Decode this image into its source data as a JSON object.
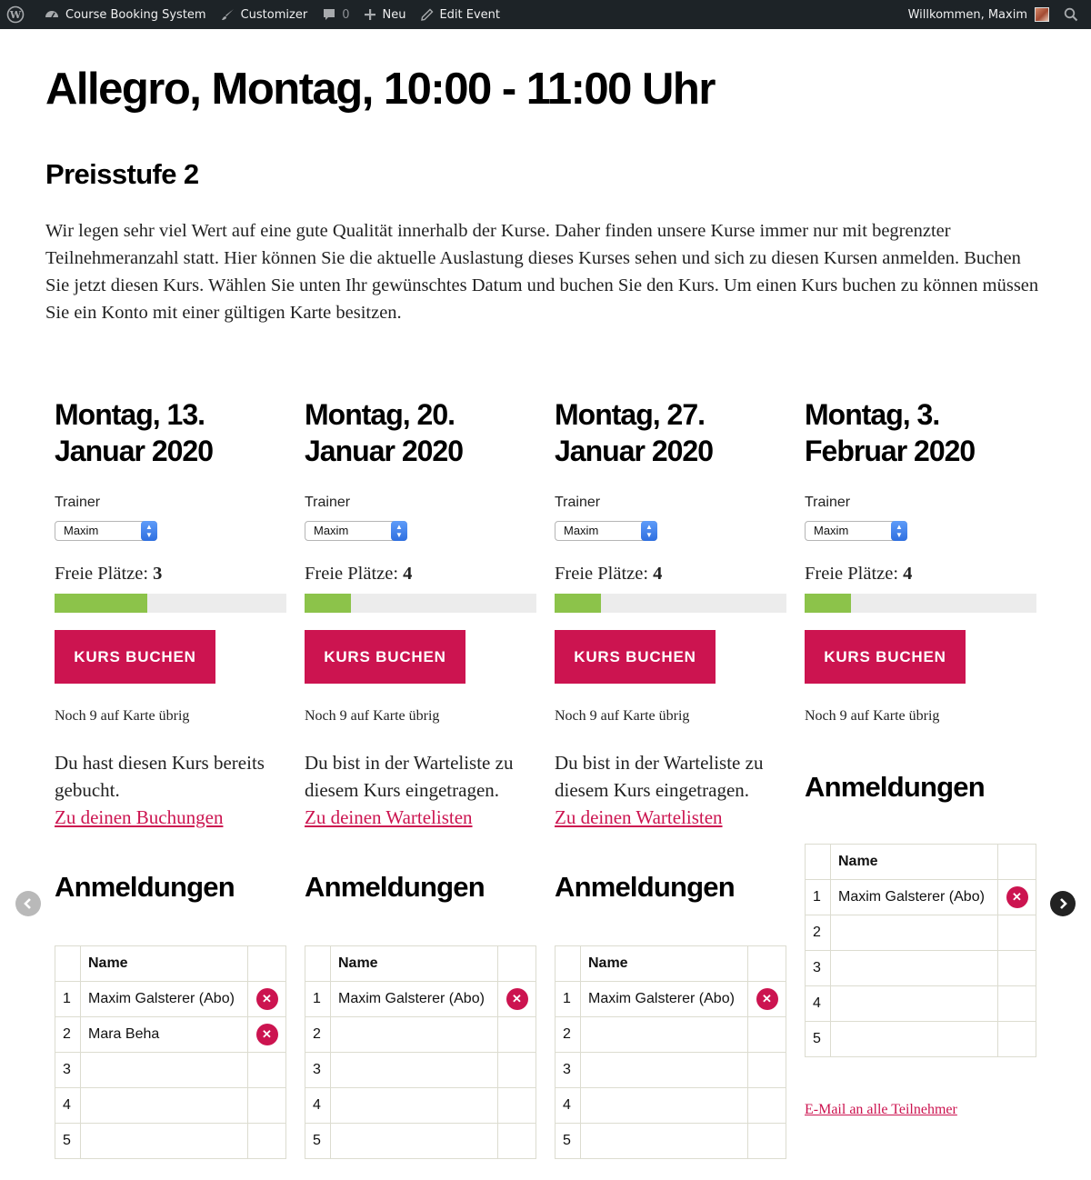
{
  "adminbar": {
    "site_name": "Course Booking System",
    "customizer": "Customizer",
    "comments_count": "0",
    "new": "Neu",
    "edit": "Edit Event",
    "welcome": "Willkommen, Maxim"
  },
  "page": {
    "title": "Allegro, Montag, 10:00 - 11:00 Uhr",
    "subtitle": "Preisstufe 2",
    "intro": "Wir legen sehr viel Wert auf eine gute Qualität innerhalb der Kurse. Daher finden unsere Kurse immer nur mit begrenzter Teilnehmeranzahl statt. Hier können Sie die aktuelle Auslastung dieses Kurses sehen und sich zu diesen Kursen anmelden. Buchen Sie jetzt diesen Kurs. Wählen Sie unten Ihr gewünschtes Datum und buchen Sie den Kurs. Um einen Kurs buchen zu können müssen Sie ein Konto mit einer gültigen Karte besitzen."
  },
  "labels": {
    "trainer": "Trainer",
    "free_spots": "Freie Plätze:",
    "book": "KURS BUCHEN",
    "card_left": "Noch 9 auf Karte übrig",
    "registrations": "Anmeldungen",
    "name_col": "Name",
    "email_all": "E-Mail an alle Teilnehmer"
  },
  "courses": [
    {
      "date_line1": "Montag, 13.",
      "date_line2": "Januar 2020",
      "trainer": "Maxim",
      "free": "3",
      "fill_fraction": 0.4,
      "status_text": "Du hast diesen Kurs bereits gebucht.",
      "status_link": "Zu deinen Buchungen",
      "rows": [
        "1",
        "2",
        "3",
        "4",
        "5"
      ],
      "names": [
        "Maxim Galsterer (Abo)",
        "Mara Beha",
        "",
        "",
        ""
      ]
    },
    {
      "date_line1": "Montag, 20.",
      "date_line2": "Januar 2020",
      "trainer": "Maxim",
      "free": "4",
      "fill_fraction": 0.2,
      "status_text": "Du bist in der Warteliste zu diesem Kurs eingetragen.",
      "status_link": "Zu deinen Wartelisten",
      "rows": [
        "1",
        "2",
        "3",
        "4",
        "5"
      ],
      "names": [
        "Maxim Galsterer (Abo)",
        "",
        "",
        "",
        ""
      ]
    },
    {
      "date_line1": "Montag, 27.",
      "date_line2": "Januar 2020",
      "trainer": "Maxim",
      "free": "4",
      "fill_fraction": 0.2,
      "status_text": "Du bist in der Warteliste zu diesem Kurs eingetragen.",
      "status_link": "Zu deinen Wartelisten",
      "rows": [
        "1",
        "2",
        "3",
        "4",
        "5"
      ],
      "names": [
        "Maxim Galsterer (Abo)",
        "",
        "",
        "",
        ""
      ]
    },
    {
      "date_line1": "Montag, 3.",
      "date_line2": "Februar 2020",
      "trainer": "Maxim",
      "free": "4",
      "fill_fraction": 0.2,
      "status_text": "",
      "status_link": "",
      "rows": [
        "1",
        "2",
        "3",
        "4",
        "5"
      ],
      "names": [
        "Maxim Galsterer (Abo)",
        "",
        "",
        "",
        ""
      ]
    }
  ],
  "colors": {
    "accent": "#cc1450",
    "progress": "#8cc34a",
    "adminbar": "#1d2327"
  },
  "icons": {
    "wordpress": "wordpress-icon",
    "site": "dashboard-icon",
    "customizer": "paintbrush-icon",
    "comments": "comment-icon",
    "new": "plus-icon",
    "edit": "pencil-icon",
    "search": "search-icon",
    "remove": "close-icon",
    "prev": "chevron-left-icon",
    "next": "chevron-right-icon"
  }
}
